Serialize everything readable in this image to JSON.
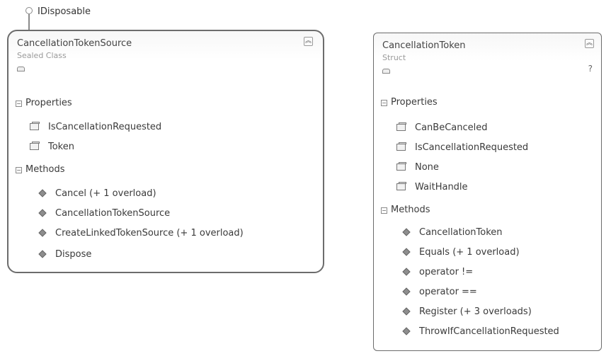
{
  "interface": {
    "label": "IDisposable"
  },
  "class_source": {
    "title": "CancellationTokenSource",
    "subtitle": "Sealed Class",
    "collapse_icon": "double-chevron-up-icon",
    "properties_label": "Properties",
    "properties": [
      "IsCancellationRequested",
      "Token"
    ],
    "methods_label": "Methods",
    "methods": [
      "Cancel (+ 1 overload)",
      "CancellationTokenSource",
      "CreateLinkedTokenSource (+ 1 overload)",
      "Dispose"
    ]
  },
  "class_token": {
    "title": "CancellationToken",
    "subtitle": "Struct",
    "collapse_icon": "double-chevron-up-icon",
    "marker": "?",
    "properties_label": "Properties",
    "properties": [
      "CanBeCanceled",
      "IsCancellationRequested",
      "None",
      "WaitHandle"
    ],
    "methods_label": "Methods",
    "methods": [
      "CancellationToken",
      "Equals (+ 1 overload)",
      "operator !=",
      "operator ==",
      "Register (+ 3 overloads)",
      "ThrowIfCancellationRequested"
    ]
  }
}
